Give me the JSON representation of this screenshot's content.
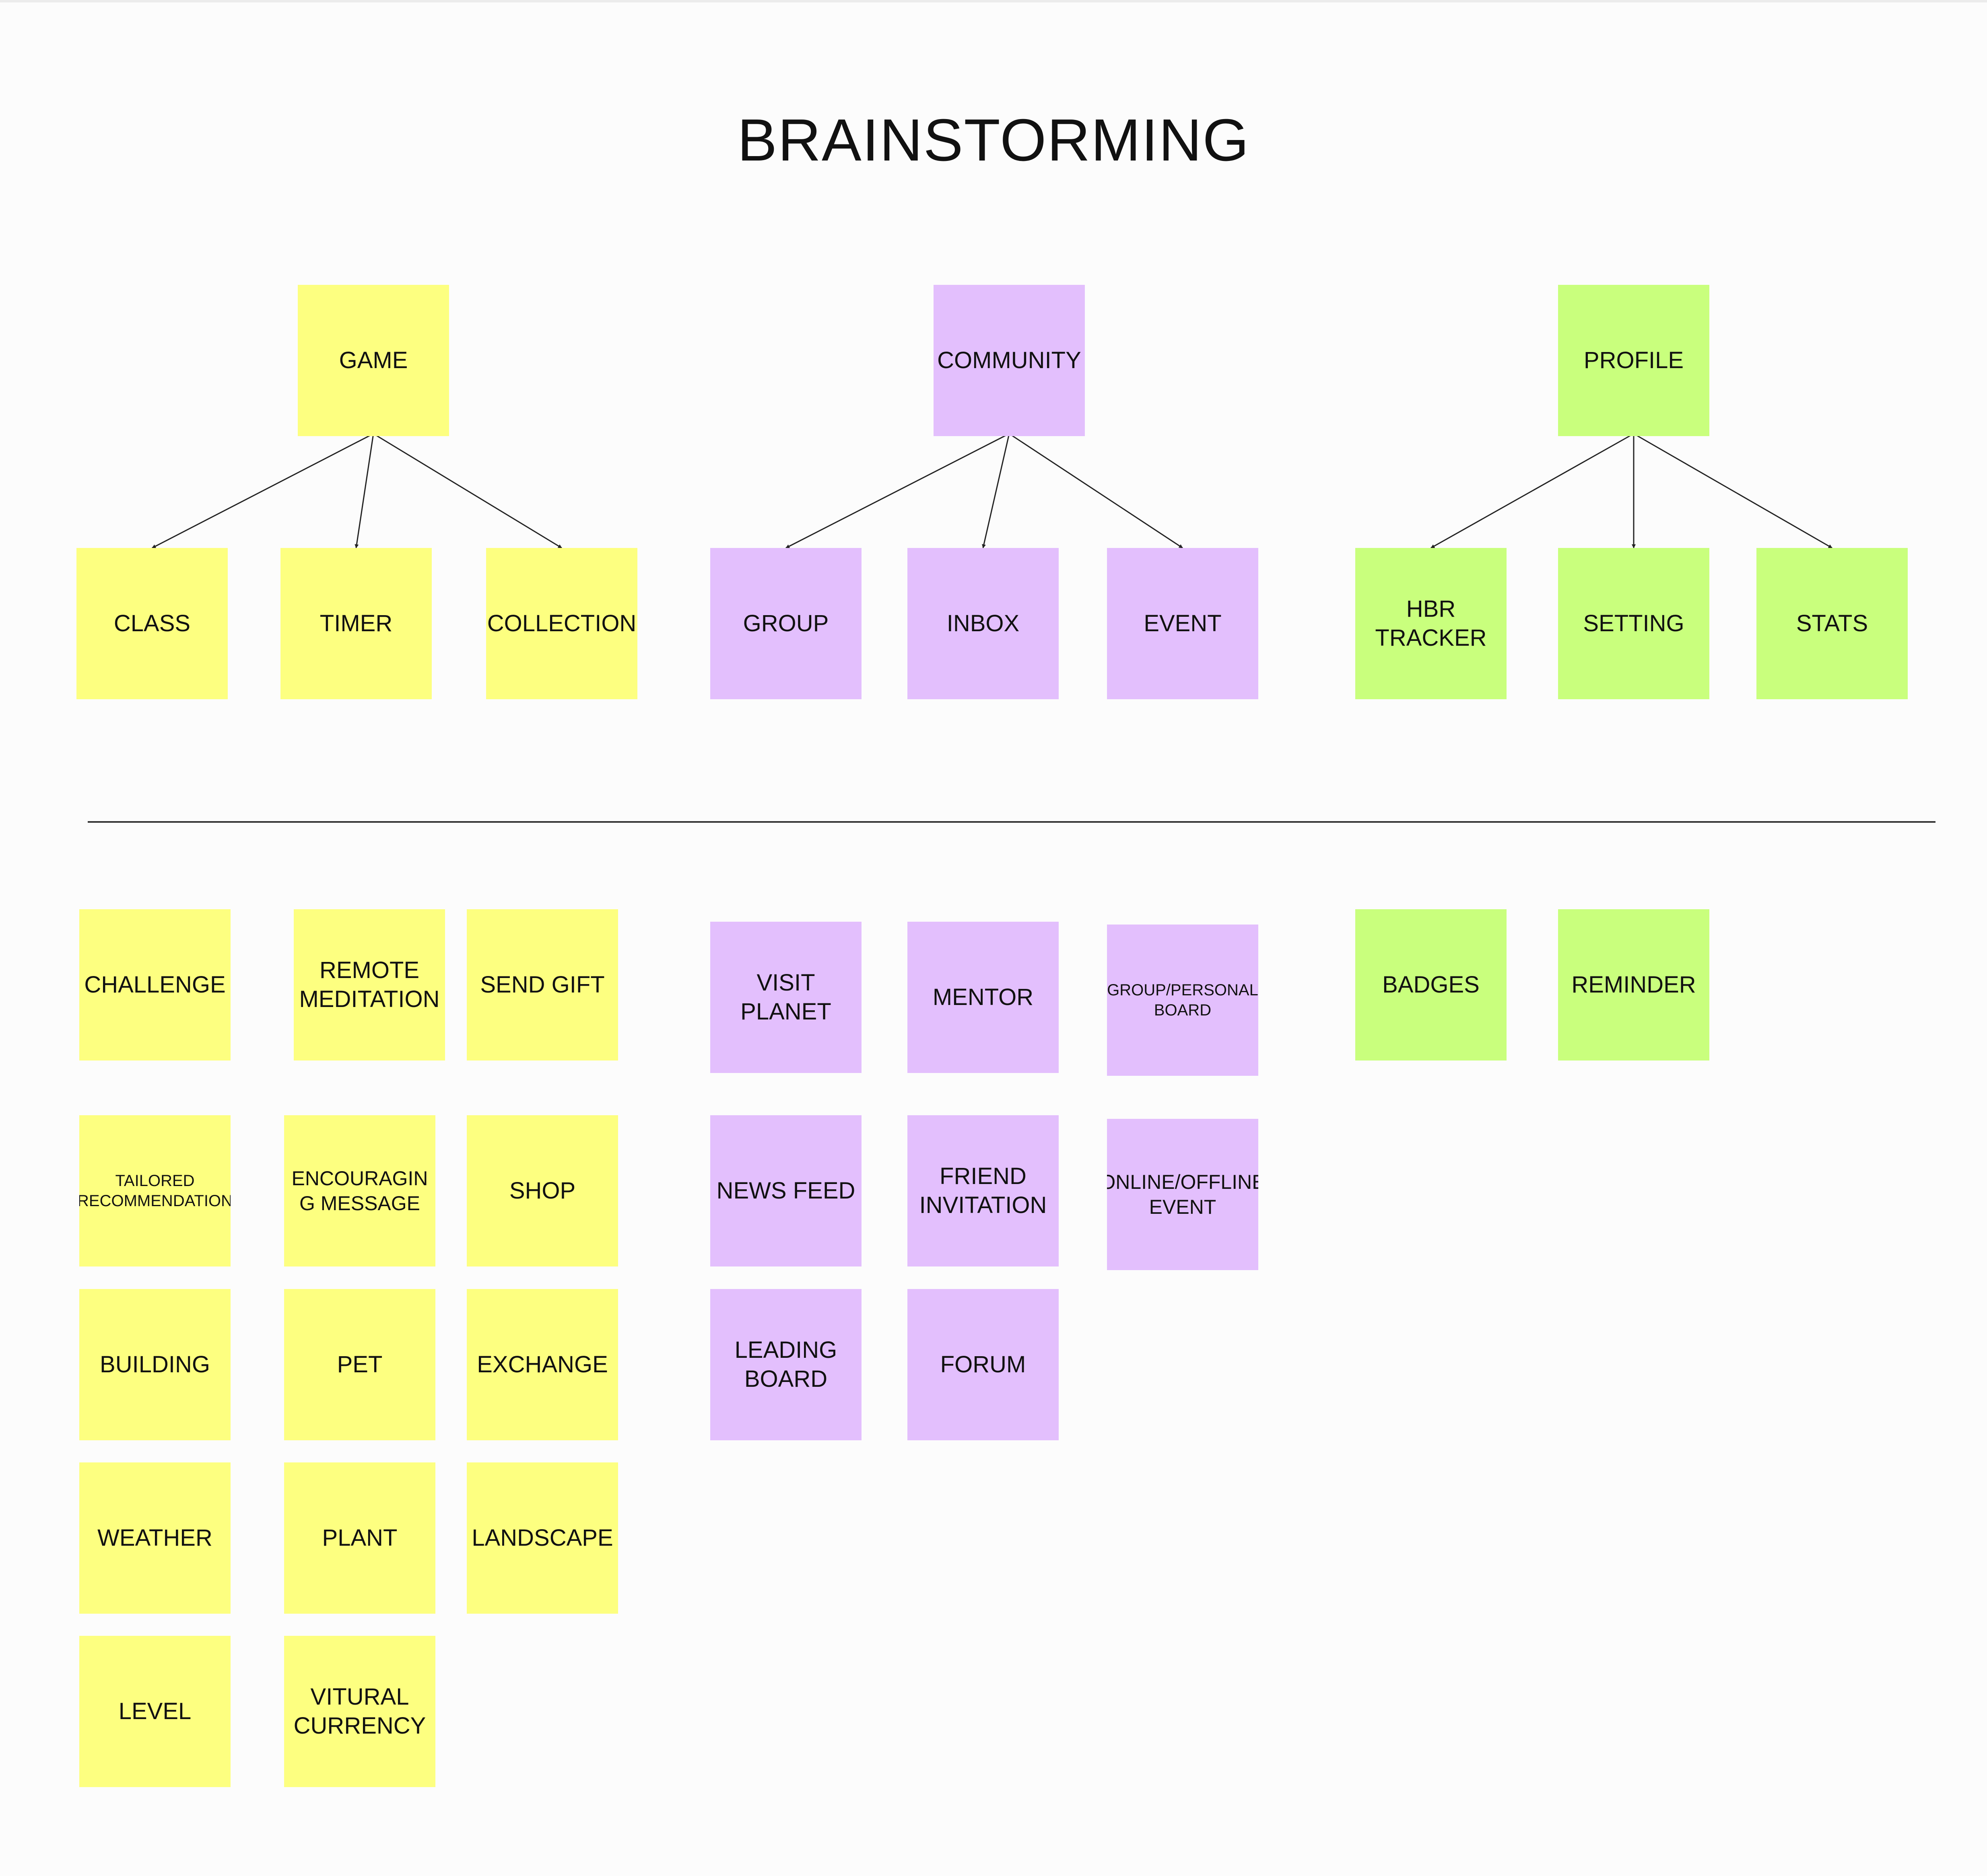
{
  "title": "BRAINSTORMING",
  "colors": {
    "game": "#fdff80",
    "community": "#e3bffd",
    "profile": "#c9ff7d",
    "line": "#222222"
  },
  "notes": [
    {
      "id": "game",
      "label": "GAME",
      "group": "game"
    },
    {
      "id": "community",
      "label": "COMMUNITY",
      "group": "community"
    },
    {
      "id": "profile",
      "label": "PROFILE",
      "group": "profile"
    },
    {
      "id": "class",
      "label": "CLASS",
      "group": "game"
    },
    {
      "id": "timer",
      "label": "TIMER",
      "group": "game"
    },
    {
      "id": "collection",
      "label": "COLLECTION",
      "group": "game"
    },
    {
      "id": "group",
      "label": "GROUP",
      "group": "community"
    },
    {
      "id": "inbox",
      "label": "INBOX",
      "group": "community"
    },
    {
      "id": "event",
      "label": "EVENT",
      "group": "community"
    },
    {
      "id": "hbr-tracker",
      "label": "HBR\nTRACKER",
      "group": "profile"
    },
    {
      "id": "setting",
      "label": "SETTING",
      "group": "profile"
    },
    {
      "id": "stats",
      "label": "STATS",
      "group": "profile"
    },
    {
      "id": "challenge",
      "label": "CHALLENGE",
      "group": "game"
    },
    {
      "id": "remote-meditation",
      "label": "REMOTE\nMEDITATION",
      "group": "game"
    },
    {
      "id": "send-gift",
      "label": "SEND GIFT",
      "group": "game"
    },
    {
      "id": "visit-planet",
      "label": "VISIT\nPLANET",
      "group": "community"
    },
    {
      "id": "mentor",
      "label": "MENTOR",
      "group": "community"
    },
    {
      "id": "group-personal-board",
      "label": "GROUP/PERSONAL\nBOARD",
      "group": "community",
      "size": "small"
    },
    {
      "id": "badges",
      "label": "BADGES",
      "group": "profile"
    },
    {
      "id": "reminder",
      "label": "REMINDER",
      "group": "profile"
    },
    {
      "id": "tailored-recommendation",
      "label": "TAILORED\nRECOMMENDATION",
      "group": "game",
      "size": "small"
    },
    {
      "id": "encouraging-message",
      "label": "ENCOURAGIN\nG MESSAGE",
      "group": "game",
      "size": "mid"
    },
    {
      "id": "shop",
      "label": "SHOP",
      "group": "game"
    },
    {
      "id": "news-feed",
      "label": "NEWS FEED",
      "group": "community"
    },
    {
      "id": "friend-invitation",
      "label": "FRIEND\nINVITATION",
      "group": "community"
    },
    {
      "id": "online-offline-event",
      "label": "ONLINE/OFFLINE\nEVENT",
      "group": "community",
      "size": "mid"
    },
    {
      "id": "building",
      "label": "BUILDING",
      "group": "game"
    },
    {
      "id": "pet",
      "label": "PET",
      "group": "game"
    },
    {
      "id": "exchange",
      "label": "EXCHANGE",
      "group": "game"
    },
    {
      "id": "leading-board",
      "label": "LEADING\nBOARD",
      "group": "community"
    },
    {
      "id": "forum",
      "label": "FORUM",
      "group": "community"
    },
    {
      "id": "weather",
      "label": "WEATHER",
      "group": "game"
    },
    {
      "id": "plant",
      "label": "PLANT",
      "group": "game"
    },
    {
      "id": "landscape",
      "label": "LANDSCAPE",
      "group": "game"
    },
    {
      "id": "level",
      "label": "LEVEL",
      "group": "game"
    },
    {
      "id": "vitural-currency",
      "label": "VITURAL\nCURRENCY",
      "group": "game"
    }
  ],
  "edges": [
    {
      "from": "game",
      "to": "class"
    },
    {
      "from": "game",
      "to": "timer"
    },
    {
      "from": "game",
      "to": "collection"
    },
    {
      "from": "community",
      "to": "group"
    },
    {
      "from": "community",
      "to": "inbox"
    },
    {
      "from": "community",
      "to": "event"
    },
    {
      "from": "profile",
      "to": "hbr-tracker"
    },
    {
      "from": "profile",
      "to": "setting"
    },
    {
      "from": "profile",
      "to": "stats"
    }
  ]
}
